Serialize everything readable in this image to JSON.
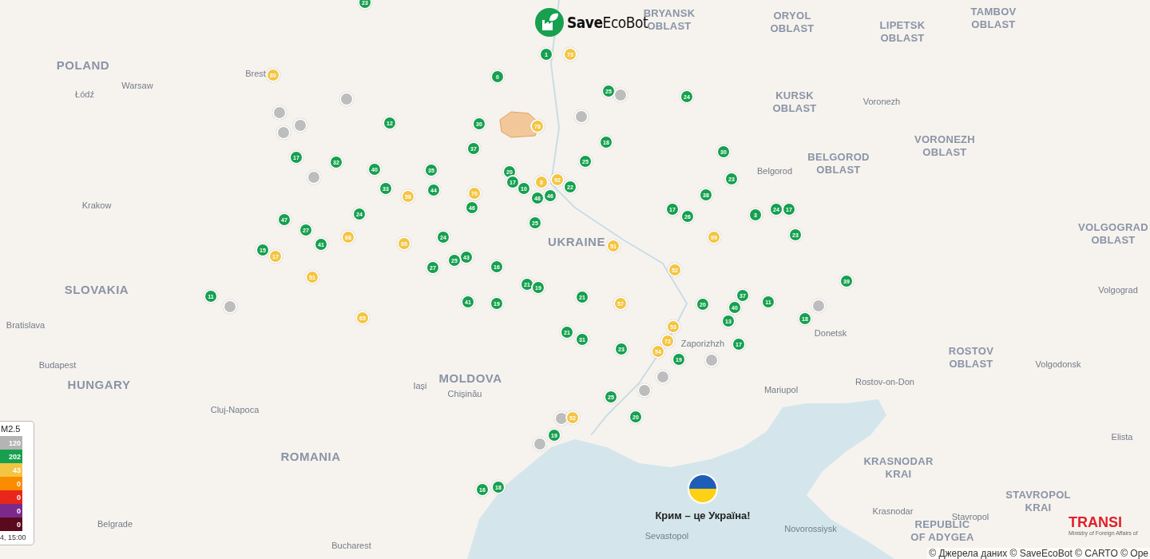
{
  "logo": {
    "text": "**Save**EcoBot"
  },
  "map_labels": [
    {
      "kind": "country",
      "lines": [
        "POLAND"
      ]
    },
    {
      "kind": "country",
      "lines": [
        "SLOVAKIA"
      ]
    },
    {
      "kind": "country",
      "lines": [
        "HUNGARY"
      ]
    },
    {
      "kind": "country",
      "lines": [
        "ROMANIA"
      ]
    },
    {
      "kind": "country",
      "lines": [
        "MOLDOVA"
      ]
    },
    {
      "kind": "country",
      "lines": [
        "UKRAINE"
      ]
    },
    {
      "kind": "region",
      "lines": [
        "BRYANSK",
        "OBLAST"
      ]
    },
    {
      "kind": "region",
      "lines": [
        "ORYOL",
        "OBLAST"
      ]
    },
    {
      "kind": "region",
      "lines": [
        "LIPETSK",
        "OBLAST"
      ]
    },
    {
      "kind": "region",
      "lines": [
        "TAMBOV",
        "OBLAST"
      ]
    },
    {
      "kind": "region",
      "lines": [
        "KURSK",
        "OBLAST"
      ]
    },
    {
      "kind": "region",
      "lines": [
        "VORONEZH",
        "OBLAST"
      ]
    },
    {
      "kind": "region",
      "lines": [
        "BELGOROD",
        "OBLAST"
      ]
    },
    {
      "kind": "region",
      "lines": [
        "VOLGOGRAD",
        "OBLAST"
      ]
    },
    {
      "kind": "region",
      "lines": [
        "ROSTOV",
        "OBLAST"
      ]
    },
    {
      "kind": "region",
      "lines": [
        "KRASNODAR",
        "KRAI"
      ]
    },
    {
      "kind": "region",
      "lines": [
        "REPUBLIC",
        "OF ADYGEA"
      ]
    },
    {
      "kind": "region",
      "lines": [
        "STAVROPOL",
        "KRAI"
      ]
    },
    {
      "kind": "city",
      "lines": [
        "Warsaw"
      ]
    },
    {
      "kind": "city",
      "lines": [
        "Łódź"
      ]
    },
    {
      "kind": "city",
      "lines": [
        "Brest"
      ]
    },
    {
      "kind": "city",
      "lines": [
        "Krakow"
      ]
    },
    {
      "kind": "city",
      "lines": [
        "Bratislava"
      ]
    },
    {
      "kind": "city",
      "lines": [
        "Budapest"
      ]
    },
    {
      "kind": "city",
      "lines": [
        "Cluj-Napoca"
      ]
    },
    {
      "kind": "city",
      "lines": [
        "Iași"
      ]
    },
    {
      "kind": "city",
      "lines": [
        "Chișinău"
      ]
    },
    {
      "kind": "city",
      "lines": [
        "Belgrade"
      ]
    },
    {
      "kind": "city",
      "lines": [
        "Bucharest"
      ]
    },
    {
      "kind": "city",
      "lines": [
        "Voronezh"
      ]
    },
    {
      "kind": "city",
      "lines": [
        "Belgorod"
      ]
    },
    {
      "kind": "city",
      "lines": [
        "Volgograd"
      ]
    },
    {
      "kind": "city",
      "lines": [
        "Donetsk"
      ]
    },
    {
      "kind": "city",
      "lines": [
        "Rostov-on-Don"
      ]
    },
    {
      "kind": "city",
      "lines": [
        "Volgodonsk"
      ]
    },
    {
      "kind": "city",
      "lines": [
        "Mariupol"
      ]
    },
    {
      "kind": "city",
      "lines": [
        "Elista"
      ]
    },
    {
      "kind": "city",
      "lines": [
        "Krasnodar"
      ]
    },
    {
      "kind": "city",
      "lines": [
        "Stavropol"
      ]
    },
    {
      "kind": "city",
      "lines": [
        "Novorossiysk"
      ]
    },
    {
      "kind": "city",
      "lines": [
        "Sevastopol"
      ]
    },
    {
      "kind": "city",
      "lines": [
        "Zaporizhzh"
      ]
    }
  ],
  "markers": [
    {
      "value": "23",
      "color": "#17a04f"
    },
    {
      "value": "1",
      "color": "#17a04f"
    },
    {
      "value": "73",
      "color": "#f4c542"
    },
    {
      "value": "0",
      "color": "#17a04f"
    },
    {
      "value": "80",
      "color": "#f4c542"
    },
    {
      "value": "25",
      "color": "#17a04f"
    },
    {
      "color": "#bdbdbd"
    },
    {
      "value": "24",
      "color": "#17a04f"
    },
    {
      "color": "#bdbdbd"
    },
    {
      "value": "12",
      "color": "#17a04f"
    },
    {
      "value": "30",
      "color": "#17a04f"
    },
    {
      "value": "78",
      "color": "#f4c542"
    },
    {
      "color": "#bdbdbd"
    },
    {
      "color": "#bdbdbd"
    },
    {
      "color": "#bdbdbd"
    },
    {
      "color": "#bdbdbd"
    },
    {
      "value": "18",
      "color": "#17a04f"
    },
    {
      "value": "37",
      "color": "#17a04f"
    },
    {
      "value": "30",
      "color": "#17a04f"
    },
    {
      "value": "17",
      "color": "#17a04f"
    },
    {
      "value": "32",
      "color": "#17a04f"
    },
    {
      "value": "40",
      "color": "#17a04f"
    },
    {
      "value": "25",
      "color": "#17a04f"
    },
    {
      "value": "35",
      "color": "#17a04f"
    },
    {
      "value": "20",
      "color": "#17a04f"
    },
    {
      "value": "17",
      "color": "#17a04f"
    },
    {
      "value": "23",
      "color": "#17a04f"
    },
    {
      "color": "#bdbdbd"
    },
    {
      "value": "33",
      "color": "#17a04f"
    },
    {
      "value": "44",
      "color": "#17a04f"
    },
    {
      "value": "70",
      "color": "#f4c542"
    },
    {
      "value": "58",
      "color": "#f4c542"
    },
    {
      "value": "48",
      "color": "#17a04f"
    },
    {
      "value": "46",
      "color": "#17a04f"
    },
    {
      "value": "22",
      "color": "#17a04f"
    },
    {
      "value": "8",
      "color": "#f4c542"
    },
    {
      "value": "92",
      "color": "#f4c542"
    },
    {
      "value": "38",
      "color": "#17a04f"
    },
    {
      "value": "10",
      "color": "#17a04f"
    },
    {
      "value": "24",
      "color": "#17a04f"
    },
    {
      "value": "46",
      "color": "#17a04f"
    },
    {
      "value": "47",
      "color": "#17a04f"
    },
    {
      "value": "17",
      "color": "#17a04f"
    },
    {
      "value": "26",
      "color": "#17a04f"
    },
    {
      "value": "3",
      "color": "#17a04f"
    },
    {
      "value": "24",
      "color": "#17a04f"
    },
    {
      "value": "17",
      "color": "#17a04f"
    },
    {
      "value": "25",
      "color": "#17a04f"
    },
    {
      "value": "27",
      "color": "#17a04f"
    },
    {
      "value": "68",
      "color": "#f4c542"
    },
    {
      "value": "24",
      "color": "#17a04f"
    },
    {
      "value": "23",
      "color": "#17a04f"
    },
    {
      "value": "99",
      "color": "#f4c542"
    },
    {
      "value": "15",
      "color": "#17a04f"
    },
    {
      "value": "17",
      "color": "#f4c542"
    },
    {
      "value": "41",
      "color": "#17a04f"
    },
    {
      "value": "95",
      "color": "#f4c542"
    },
    {
      "value": "51",
      "color": "#f4c542"
    },
    {
      "value": "43",
      "color": "#17a04f"
    },
    {
      "value": "25",
      "color": "#17a04f"
    },
    {
      "value": "27",
      "color": "#17a04f"
    },
    {
      "value": "16",
      "color": "#17a04f"
    },
    {
      "value": "52",
      "color": "#f4c542"
    },
    {
      "value": "51",
      "color": "#f4c542"
    },
    {
      "value": "11",
      "color": "#17a04f"
    },
    {
      "color": "#bdbdbd"
    },
    {
      "value": "21",
      "color": "#17a04f"
    },
    {
      "value": "19",
      "color": "#17a04f"
    },
    {
      "value": "37",
      "color": "#17a04f"
    },
    {
      "value": "39",
      "color": "#17a04f"
    },
    {
      "value": "11",
      "color": "#17a04f"
    },
    {
      "value": "20",
      "color": "#17a04f"
    },
    {
      "value": "40",
      "color": "#17a04f"
    },
    {
      "value": "41",
      "color": "#17a04f"
    },
    {
      "value": "19",
      "color": "#17a04f"
    },
    {
      "value": "21",
      "color": "#17a04f"
    },
    {
      "value": "57",
      "color": "#f4c542"
    },
    {
      "color": "#bdbdbd"
    },
    {
      "value": "65",
      "color": "#f4c542"
    },
    {
      "value": "18",
      "color": "#17a04f"
    },
    {
      "value": "13",
      "color": "#17a04f"
    },
    {
      "value": "21",
      "color": "#17a04f"
    },
    {
      "value": "31",
      "color": "#17a04f"
    },
    {
      "value": "53",
      "color": "#f4c542"
    },
    {
      "value": "72",
      "color": "#f4c542"
    },
    {
      "value": "54",
      "color": "#f4c542"
    },
    {
      "value": "23",
      "color": "#17a04f"
    },
    {
      "value": "17",
      "color": "#17a04f"
    },
    {
      "color": "#bdbdbd"
    },
    {
      "value": "19",
      "color": "#17a04f"
    },
    {
      "color": "#bdbdbd"
    },
    {
      "color": "#bdbdbd"
    },
    {
      "value": "25",
      "color": "#17a04f"
    },
    {
      "color": "#bdbdbd"
    },
    {
      "value": "52",
      "color": "#f4c542"
    },
    {
      "value": "19",
      "color": "#17a04f"
    },
    {
      "color": "#bdbdbd"
    },
    {
      "value": "20",
      "color": "#17a04f"
    },
    {
      "value": "16",
      "color": "#17a04f"
    },
    {
      "value": "18",
      "color": "#17a04f"
    }
  ],
  "legend": {
    "title": "M2.5",
    "rows": [
      {
        "count": "120",
        "color": "#b4b4b4"
      },
      {
        "count": "202",
        "color": "#17a04f"
      },
      {
        "count": "43",
        "color": "#f4c542"
      },
      {
        "count": "0",
        "color": "#fb8c00"
      },
      {
        "count": "0",
        "color": "#e8271a"
      },
      {
        "count": "0",
        "color": "#7b2a8c"
      },
      {
        "count": "0",
        "color": "#5a0a1c"
      }
    ],
    "updated": "4, 15:00"
  },
  "crimea": {
    "caption": "Крим – це Україна!"
  },
  "partner": {
    "name": "TRANSI",
    "subtitle": "Ministry of Foreign Affairs of"
  },
  "attribution": "© Джерела даних © SaveEcoBot © CARTO  © Ope"
}
